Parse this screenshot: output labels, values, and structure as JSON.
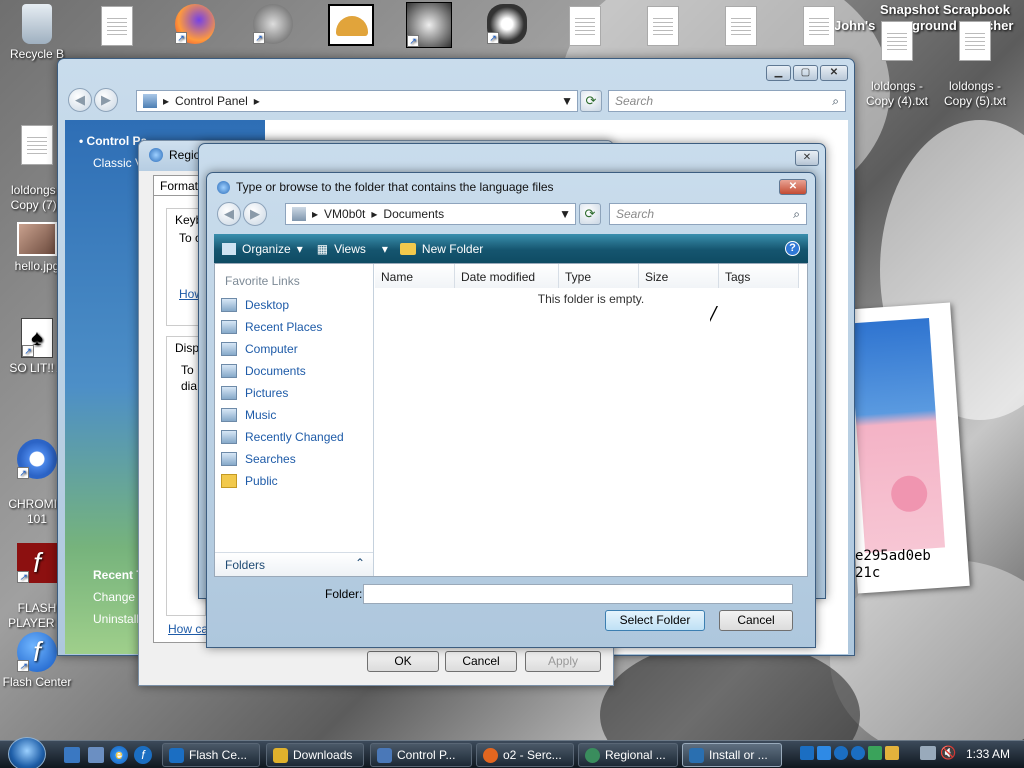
{
  "desktop": {
    "icons": [
      {
        "label": "Recycle B"
      },
      {
        "label": "loldongs -\nCopy (7).t"
      },
      {
        "label": "hello.jpg"
      },
      {
        "label": "SO LIT!! A"
      },
      {
        "label": "CHROMIU\n101"
      },
      {
        "label": "FLASH\nPLAYER P"
      },
      {
        "label": "Flash Center"
      },
      {
        "label": "loldongs -\nCopy (4).txt"
      },
      {
        "label": "loldongs -\nCopy (5).txt"
      }
    ],
    "overlay_text": {
      "line1": "Snapshot Scrapbook",
      "line2": "John's",
      "line3": "ground",
      "line4": "cher",
      "hash1": "e295ad0eb",
      "hash2": "21c"
    }
  },
  "control_panel": {
    "address": "Control Panel",
    "search_placeholder": "Search",
    "side_title": "Control Pa",
    "side_item": "Classic V",
    "recent_title": "Recent T",
    "recent_1": "Change",
    "recent_2": "Uninstall",
    "minimize": "▁",
    "maximize": "▢",
    "close": "✕"
  },
  "regional": {
    "title": "Regio",
    "tab": "Formats",
    "kbd_title": "Keyb",
    "kbd_text": "To c",
    "kbd_link": "How",
    "disp_title": "Disp",
    "disp_text1": "To",
    "disp_text2": "dia",
    "bottom_link": "How ca",
    "ok": "OK",
    "cancel": "Cancel",
    "apply": "Apply"
  },
  "mid_dialog": {
    "close": "✕"
  },
  "folder_dialog": {
    "title": "Type or browse to the folder that contains the language files",
    "path_root": "VM0b0t",
    "path_leaf": "Documents",
    "search_placeholder": "Search",
    "organize": "Organize",
    "views": "Views",
    "new_folder": "New Folder",
    "favorites_title": "Favorite Links",
    "links": [
      "Desktop",
      "Recent Places",
      "Computer",
      "Documents",
      "Pictures",
      "Music",
      "Recently Changed",
      "Searches",
      "Public"
    ],
    "folders_label": "Folders",
    "columns": [
      "Name",
      "Date modified",
      "Type",
      "Size",
      "Tags"
    ],
    "empty_message": "This folder is empty.",
    "folder_label": "Folder:",
    "folder_value": "",
    "select_button": "Select Folder",
    "cancel_button": "Cancel",
    "close": "✕"
  },
  "taskbar": {
    "tasks": [
      {
        "label": "Flash Ce...",
        "color": "#1b6ec2"
      },
      {
        "label": "Downloads",
        "color": "#e0b12c"
      },
      {
        "label": "Control P...",
        "color": "#4a78b8"
      },
      {
        "label": "o2 - Serc...",
        "color": "#e3661f"
      },
      {
        "label": "Regional ...",
        "color": "#3a8d5d"
      },
      {
        "label": "Install or ...",
        "color": "#2a6fb0"
      }
    ],
    "clock": "1:33 AM"
  }
}
